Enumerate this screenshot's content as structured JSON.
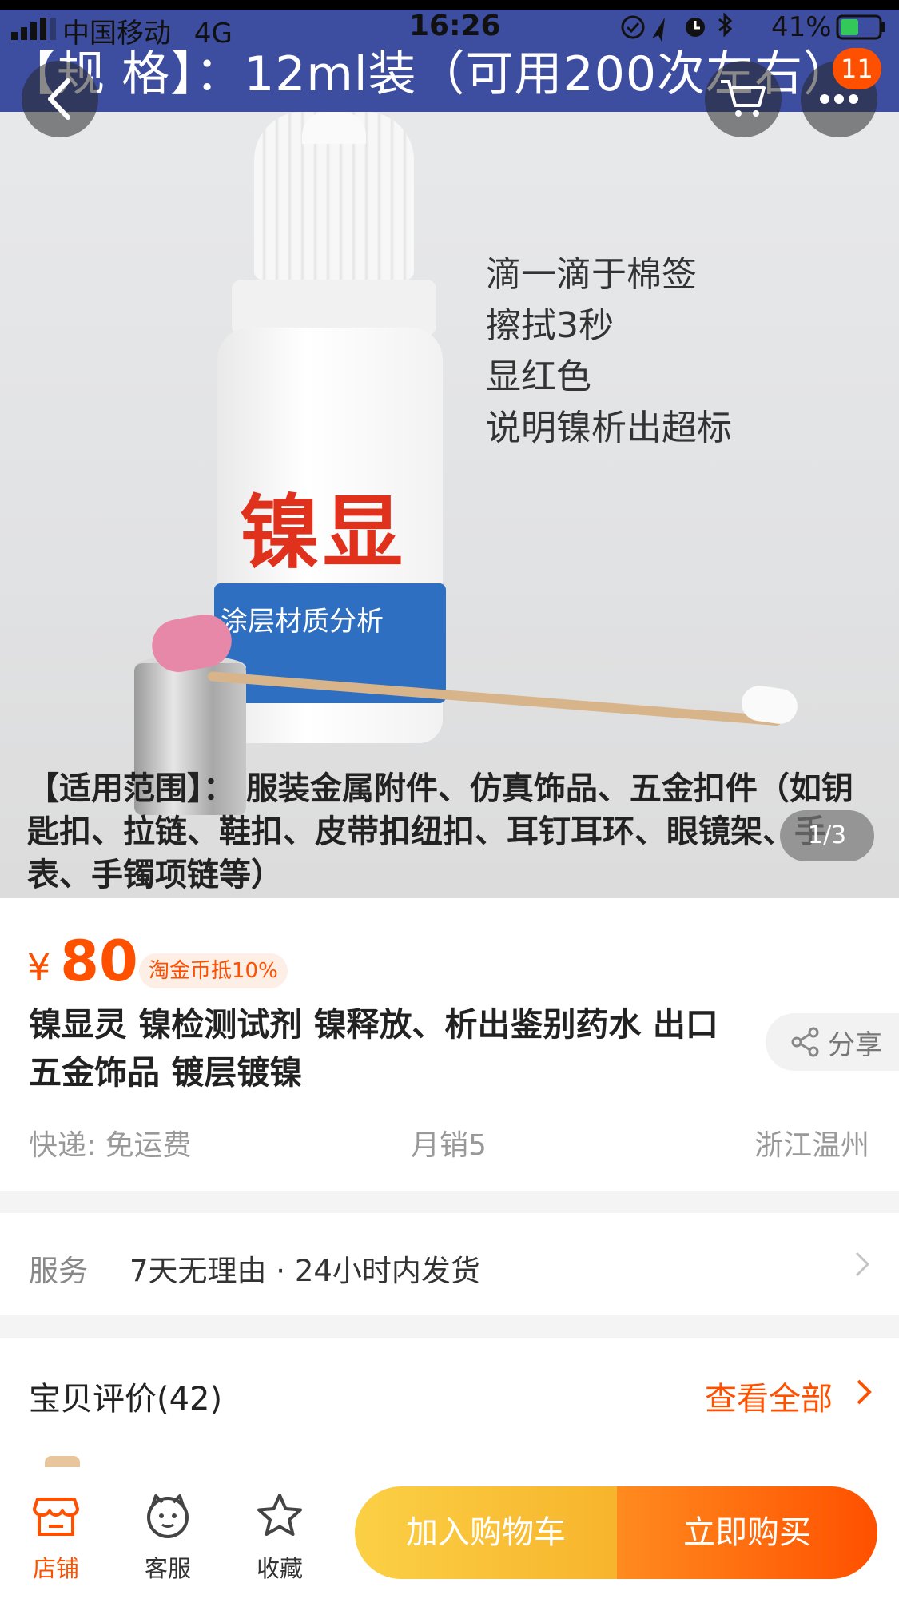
{
  "status_bar": {
    "carrier": "中国移动",
    "network": "4G",
    "time": "16:26",
    "battery": "41%"
  },
  "gallery": {
    "spec_text": "【规  格】：12ml装（可用200次左右）",
    "product_brand": "镍显",
    "band_text": "涂层材质分析",
    "instructions": [
      "滴一滴于棉签",
      "擦拭3秒",
      "显红色",
      "说明镍析出超标"
    ],
    "usage_text": "【适用范围】：  服装金属附件、仿真饰品、五金扣件（如钥匙扣、拉链、鞋扣、皮带扣纽扣、耳钉耳环、眼镜架、手表、手镯项链等）",
    "pager": "1/3"
  },
  "nav": {
    "badge_count": "11",
    "icons": {
      "back": "chevron-left-icon",
      "cart": "cart-icon",
      "more": "more-icon"
    }
  },
  "product": {
    "currency": "¥",
    "price": "80",
    "coupon": "淘金币抵10%",
    "title": "镍显灵 镍检测试剂 镍释放、析出鉴别药水 出口五金饰品 镀层镀镍",
    "share_label": "分享",
    "shipping": "快递: 免运费",
    "monthly_sales": "月销5",
    "location": "浙江温州"
  },
  "service": {
    "label": "服务",
    "value": "7天无理由 · 24小时内发货"
  },
  "reviews": {
    "title": "宝贝评价(42)",
    "view_all": "查看全部"
  },
  "bottom_bar": {
    "shop_label": "店铺",
    "service_label": "客服",
    "favorite_label": "收藏",
    "add_to_cart": "加入购物车",
    "buy_now": "立即购买"
  },
  "colors": {
    "accent": "#ff5000",
    "cart_button": "#f7b42c",
    "spec_banner": "#3d4da0"
  }
}
